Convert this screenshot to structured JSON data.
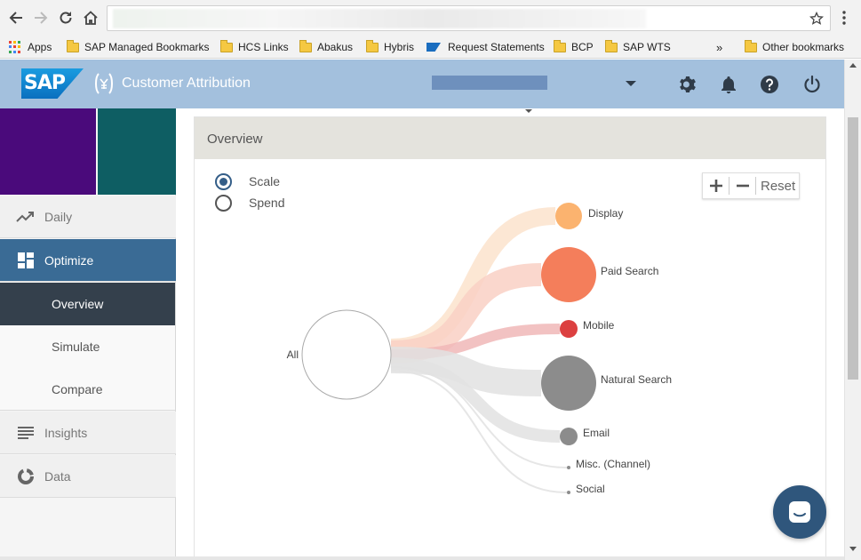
{
  "bookmarks": {
    "items": [
      {
        "label": "Apps",
        "icon": "apps-grid-icon"
      },
      {
        "label": "SAP Managed Bookmarks",
        "icon": "folder-icon"
      },
      {
        "label": "HCS Links",
        "icon": "folder-icon"
      },
      {
        "label": "Abakus",
        "icon": "folder-icon"
      },
      {
        "label": "Hybris",
        "icon": "folder-icon"
      },
      {
        "label": "Request Statements",
        "icon": "sap-icon"
      },
      {
        "label": "BCP",
        "icon": "folder-icon"
      },
      {
        "label": "SAP WTS",
        "icon": "folder-icon"
      }
    ],
    "overflow": "»",
    "other": "Other bookmarks"
  },
  "header": {
    "logo_text": "SAP",
    "title": "Customer Attribution",
    "brand_color": "#a3c0dd"
  },
  "sidebar": {
    "items": [
      {
        "label": "Daily",
        "icon": "trending-up-icon"
      },
      {
        "label": "Optimize",
        "icon": "dashboard-icon"
      },
      {
        "label": "Insights",
        "icon": "list-lines-icon"
      },
      {
        "label": "Data",
        "icon": "donut-icon"
      }
    ],
    "subitems": [
      {
        "label": "Overview"
      },
      {
        "label": "Simulate"
      },
      {
        "label": "Compare"
      }
    ],
    "active_item": "Optimize",
    "active_subitem": "Overview",
    "active_color": "#3a6b95"
  },
  "panel": {
    "title": "Overview",
    "radio_options": [
      {
        "label": "Scale",
        "checked": true
      },
      {
        "label": "Spend",
        "checked": false
      }
    ],
    "zoom": {
      "plus": "+",
      "minus": "−",
      "reset": "Reset"
    }
  },
  "chart_data": {
    "type": "sankey",
    "root": "All",
    "nodes": [
      {
        "name": "Display",
        "color": "#fbb36f",
        "flow_color": "#fbe3cc"
      },
      {
        "name": "Paid Search",
        "color": "#f47e5b",
        "flow_color": "#f9d0c4"
      },
      {
        "name": "Mobile",
        "color": "#dc4040",
        "flow_color": "#f0b7b7"
      },
      {
        "name": "Natural Search",
        "color": "#8c8c8c",
        "flow_color": "#e2e2e2"
      },
      {
        "name": "Email",
        "color": "#8c8c8c",
        "flow_color": "#e2e2e2"
      },
      {
        "name": "Misc. (Channel)",
        "color": "#8c8c8c",
        "flow_color": "#e2e2e2"
      },
      {
        "name": "Social",
        "color": "#8c8c8c",
        "flow_color": "#e2e2e2"
      }
    ]
  }
}
